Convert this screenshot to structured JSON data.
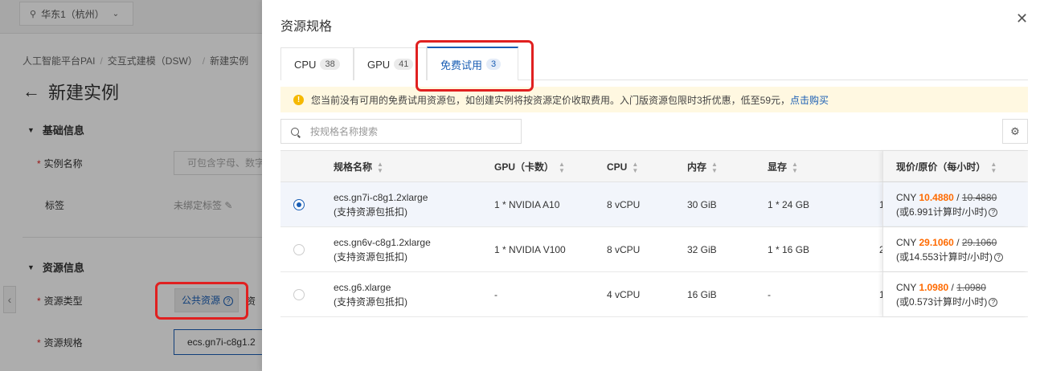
{
  "background": {
    "region": "华东1（杭州）",
    "breadcrumb": [
      "人工智能平台PAI",
      "交互式建模（DSW）",
      "新建实例"
    ],
    "page_title": "新建实例",
    "section_basic": "基础信息",
    "label_name": "实例名称",
    "name_placeholder": "可包含字母、数字",
    "label_tags": "标签",
    "tags_value": "未绑定标签",
    "section_resource": "资源信息",
    "label_resource_type": "资源类型",
    "resource_type_public": "公共资源",
    "resource_type_other": "资",
    "label_resource_spec": "资源规格",
    "resource_spec_value": "ecs.gn7i-c8g1.2"
  },
  "drawer": {
    "title": "资源规格",
    "tabs": [
      {
        "label": "CPU",
        "count": "38"
      },
      {
        "label": "GPU",
        "count": "41"
      },
      {
        "label": "免费试用",
        "count": "3"
      }
    ],
    "notice": "您当前没有可用的免费试用资源包，如创建实例将按资源定价收取费用。入门版资源包限时3折优惠，低至59元，",
    "notice_link": "点击购买",
    "search_placeholder": "按规格名称搜索",
    "columns": [
      "规格名称",
      "GPU（卡数）",
      "CPU",
      "内存",
      "显存",
      "现价/原价（每小时）"
    ],
    "rows": [
      {
        "name": "ecs.gn7i-c8g1.2xlarge",
        "note": "(支持资源包抵扣)",
        "gpu": "1 * NVIDIA A10",
        "cpu": "8 vCPU",
        "mem": "30 GiB",
        "vram": "1 * 24 GB",
        "cut": "1",
        "currency": "CNY",
        "price_now": "10.4880",
        "slash": "/",
        "price_orig": "10.4880",
        "price_note": "(或6.991计算时/小时)"
      },
      {
        "name": "ecs.gn6v-c8g1.2xlarge",
        "note": "(支持资源包抵扣)",
        "gpu": "1 * NVIDIA V100",
        "cpu": "8 vCPU",
        "mem": "32 GiB",
        "vram": "1 * 16 GB",
        "cut": "2",
        "currency": "CNY",
        "price_now": "29.1060",
        "slash": "/",
        "price_orig": "29.1060",
        "price_note": "(或14.553计算时/小时)"
      },
      {
        "name": "ecs.g6.xlarge",
        "note": "(支持资源包抵扣)",
        "gpu": "-",
        "cpu": "4 vCPU",
        "mem": "16 GiB",
        "vram": "-",
        "cut": "1",
        "currency": "CNY",
        "price_now": "1.0980",
        "slash": "/",
        "price_orig": "1.0980",
        "price_note": "(或0.573计算时/小时)"
      }
    ]
  },
  "colors": {
    "accent": "#1a5eb4",
    "price": "#ff6a00",
    "highlight": "#e02020"
  }
}
